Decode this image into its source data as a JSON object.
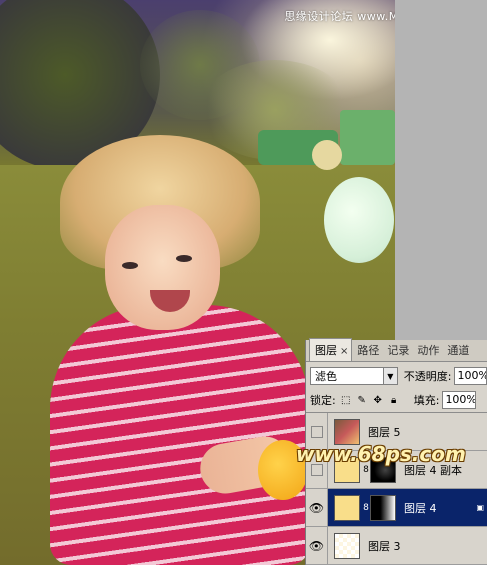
{
  "watermarks": {
    "top": "思缘设计论坛 www.MISSYUAN.com",
    "middle": "www.68ps.com"
  },
  "layers_panel": {
    "tabs": [
      {
        "label": "图层",
        "active": true
      },
      {
        "label": "路径",
        "active": false
      },
      {
        "label": "记录",
        "active": false
      },
      {
        "label": "动作",
        "active": false
      },
      {
        "label": "通道",
        "active": false
      }
    ],
    "blend_mode": "滤色",
    "opacity_label": "不透明度:",
    "opacity_value": "100%",
    "lock_label": "锁定:",
    "fill_label": "填充:",
    "fill_value": "100%",
    "layers": [
      {
        "name": "图层 5",
        "visible": false,
        "thumb": "photo",
        "mask": false,
        "selected": false
      },
      {
        "name": "图层 4 副本",
        "visible": false,
        "thumb": "yellow",
        "mask": "dark",
        "selected": false
      },
      {
        "name": "图层 4",
        "visible": true,
        "thumb": "yellow",
        "mask": "gradient",
        "selected": true
      },
      {
        "name": "图层 3",
        "visible": true,
        "thumb": "checker",
        "mask": false,
        "selected": false
      }
    ]
  }
}
